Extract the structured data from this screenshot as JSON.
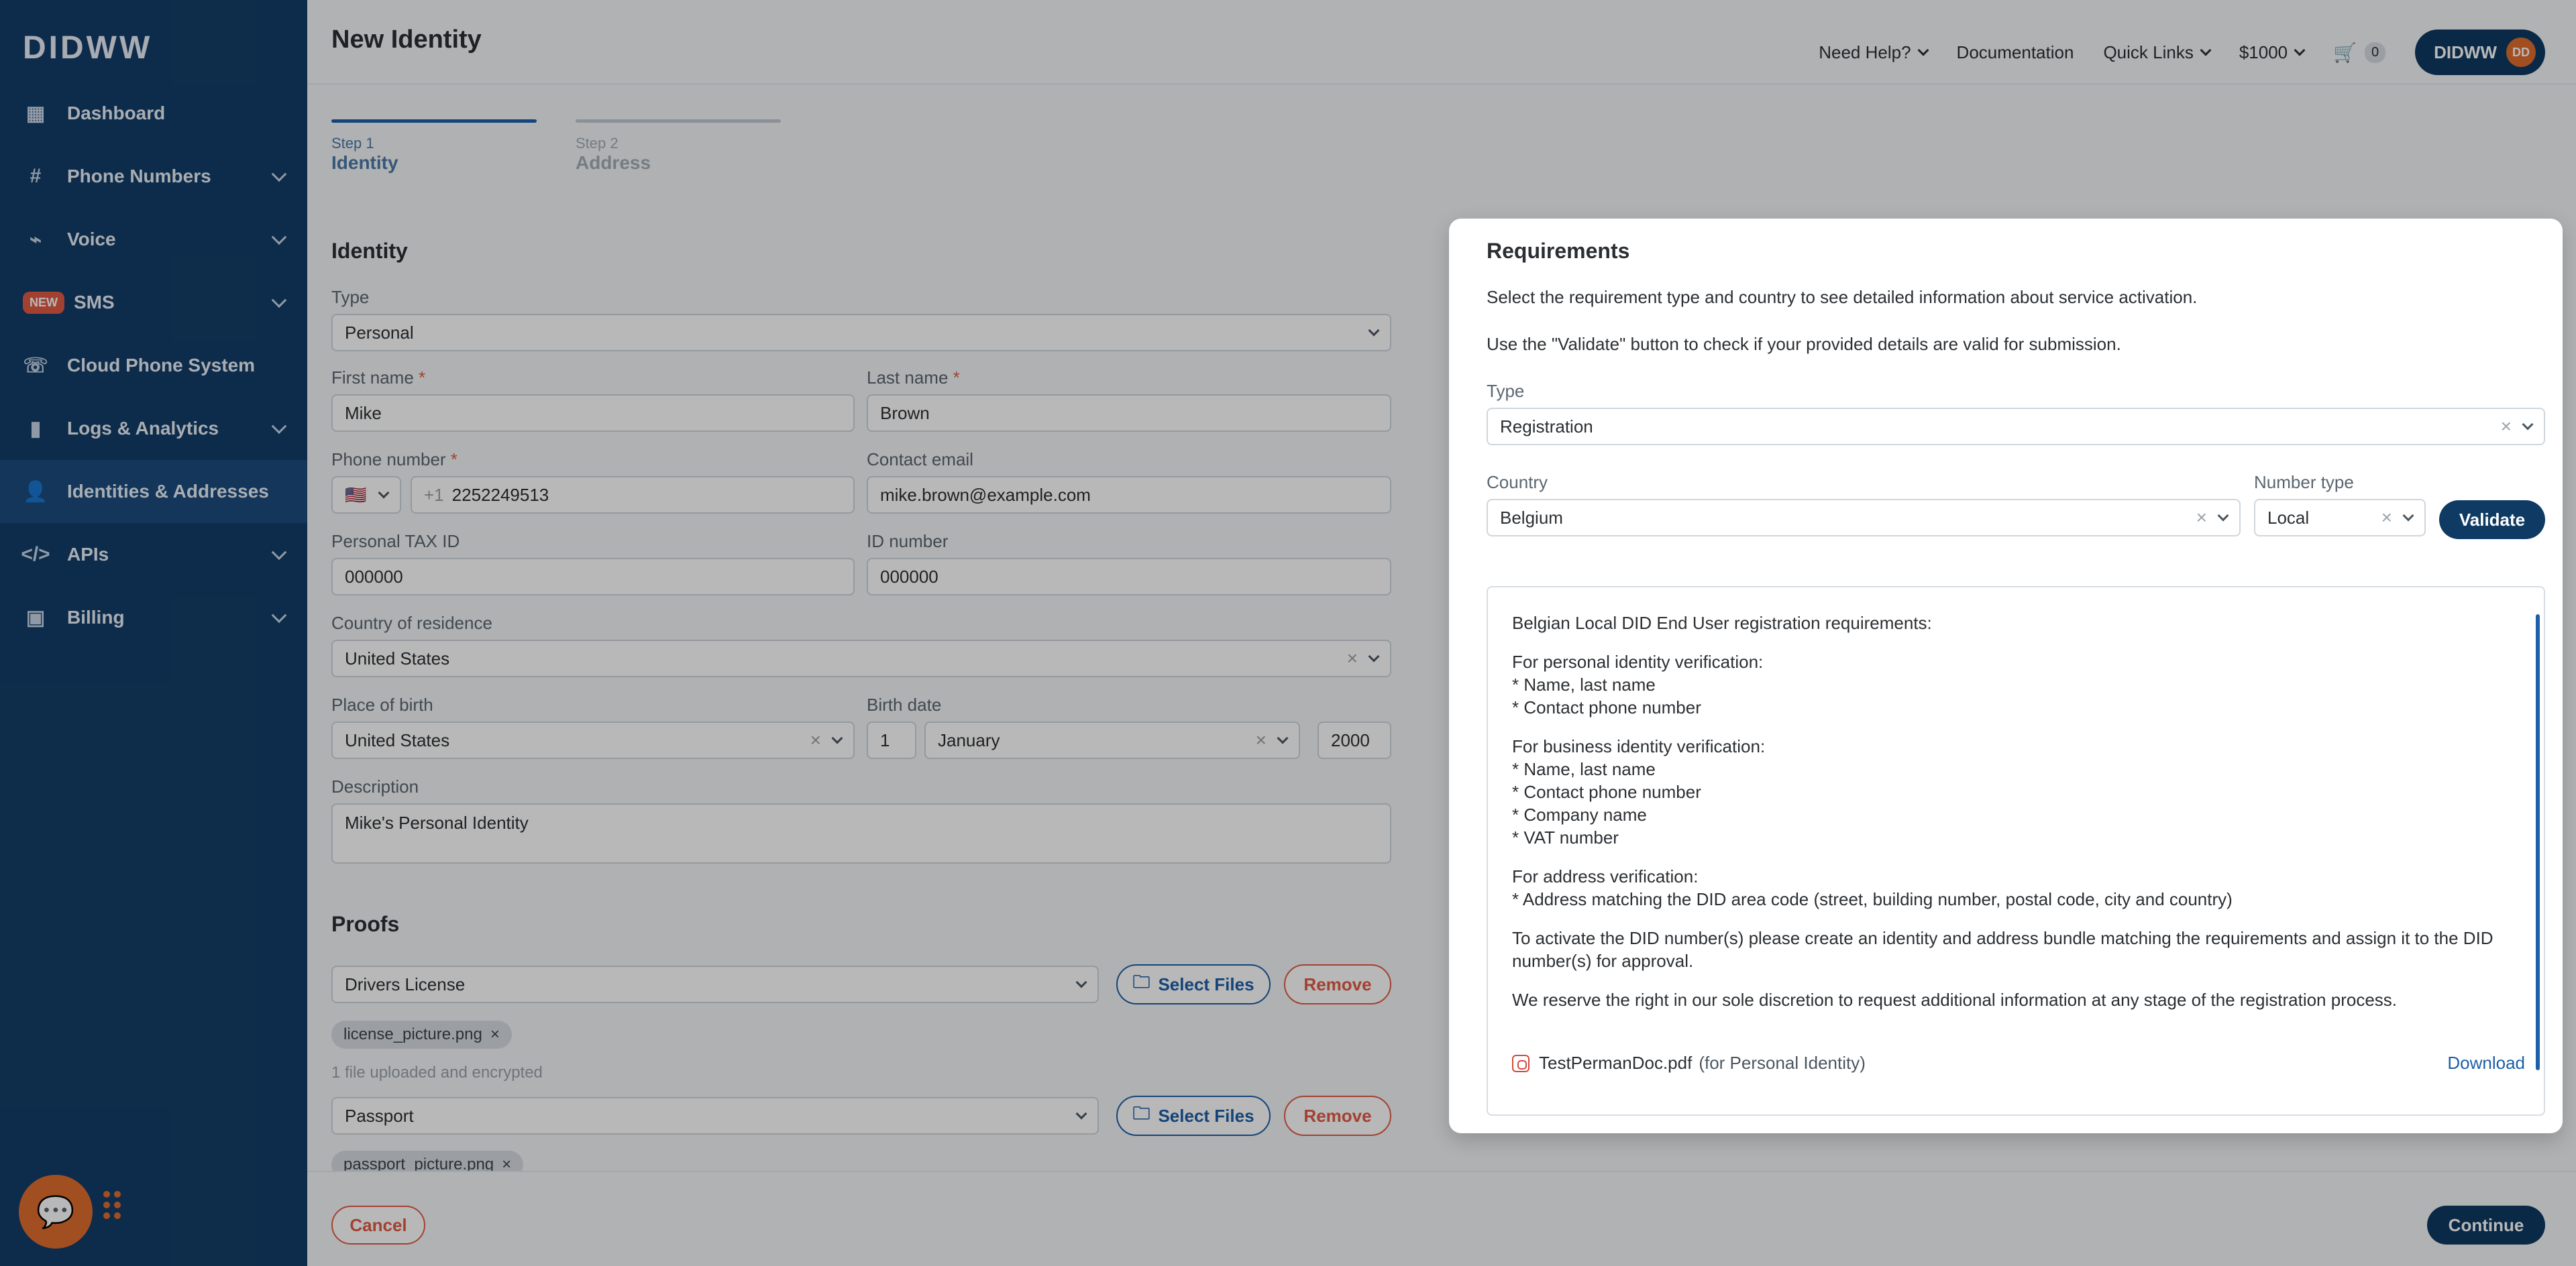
{
  "app": {
    "logo": "DIDWW",
    "page_title": "New Identity"
  },
  "sidebar": {
    "items": [
      {
        "label": "Dashboard",
        "icon": "grid-icon",
        "has_chevron": false,
        "active": false
      },
      {
        "label": "Phone Numbers",
        "icon": "hash-icon",
        "has_chevron": true,
        "active": false
      },
      {
        "label": "Voice",
        "icon": "voice-icon",
        "has_chevron": true,
        "active": false
      },
      {
        "label": "SMS",
        "icon": "new-badge",
        "badge": "NEW",
        "has_chevron": true,
        "active": false
      },
      {
        "label": "Cloud Phone System",
        "icon": "phone-icon",
        "has_chevron": false,
        "active": false
      },
      {
        "label": "Logs & Analytics",
        "icon": "bar-chart-icon",
        "has_chevron": true,
        "active": false
      },
      {
        "label": "Identities & Addresses",
        "icon": "user-icon",
        "has_chevron": false,
        "active": true
      },
      {
        "label": "APIs",
        "icon": "code-icon",
        "has_chevron": true,
        "active": false
      },
      {
        "label": "Billing",
        "icon": "wallet-icon",
        "has_chevron": true,
        "active": false
      }
    ]
  },
  "topbar": {
    "need_help": "Need Help?",
    "documentation": "Documentation",
    "quick_links": "Quick Links",
    "balance": "$1000",
    "cart_count": "0",
    "account_name": "DIDWW",
    "avatar_initials": "DD"
  },
  "steps": [
    {
      "small": "Step 1",
      "name": "Identity",
      "active": true
    },
    {
      "small": "Step 2",
      "name": "Address",
      "active": false
    }
  ],
  "form": {
    "identity_title": "Identity",
    "type_label": "Type",
    "type_value": "Personal",
    "first_name_label": "First name",
    "first_name_value": "Mike",
    "last_name_label": "Last name",
    "last_name_value": "Brown",
    "phone_label": "Phone number",
    "phone_country": "🇺🇸",
    "phone_prefix": "+1",
    "phone_value": "2252249513",
    "contact_email_label": "Contact email",
    "contact_email_value": "mike.brown@example.com",
    "tax_id_label": "Personal TAX ID",
    "tax_id_value": "000000",
    "id_number_label": "ID number",
    "id_number_value": "000000",
    "country_res_label": "Country of residence",
    "country_res_value": "United States",
    "birth_place_label": "Place of birth",
    "birth_place_value": "United States",
    "birth_date_label": "Birth date",
    "birth_day": "1",
    "birth_month": "January",
    "birth_year": "2000",
    "description_label": "Description",
    "description_value": "Mike's Personal Identity",
    "proofs_title": "Proofs",
    "proof1_type": "Drivers License",
    "proof1_file": "license_picture.png",
    "proof1_note": "1 file uploaded and encrypted",
    "proof2_type": "Passport",
    "proof2_file": "passport_picture.png",
    "select_files": "Select Files",
    "remove": "Remove"
  },
  "bottom": {
    "cancel": "Cancel",
    "continue": "Continue"
  },
  "requirements": {
    "title": "Requirements",
    "desc1": "Select the requirement type and country to see detailed information about service activation.",
    "desc2": "Use the \"Validate\" button to check if your provided details are valid for submission.",
    "type_label": "Type",
    "type_value": "Registration",
    "country_label": "Country",
    "country_value": "Belgium",
    "number_type_label": "Number type",
    "number_type_value": "Local",
    "validate": "Validate",
    "info": {
      "heading": "Belgian Local DID End User registration requirements:",
      "personal_title": "For personal identity verification:",
      "personal_items": [
        "* Name, last name",
        "* Contact phone number"
      ],
      "business_title": "For business identity verification:",
      "business_items": [
        "* Name, last name",
        "* Contact phone number",
        "* Company name",
        "* VAT number"
      ],
      "address_title": "For address verification:",
      "address_items": [
        "* Address matching the DID area code (street, building number, postal code, city and country)"
      ],
      "activation": "To activate the DID number(s) please create an identity and address bundle matching the requirements and assign it to the DID number(s) for approval.",
      "reserve": "We reserve the right in our sole discretion to request additional information at any stage of the registration process."
    },
    "file_name": "TestPermanDoc.pdf",
    "file_note": "(for Personal Identity)",
    "download": "Download"
  }
}
